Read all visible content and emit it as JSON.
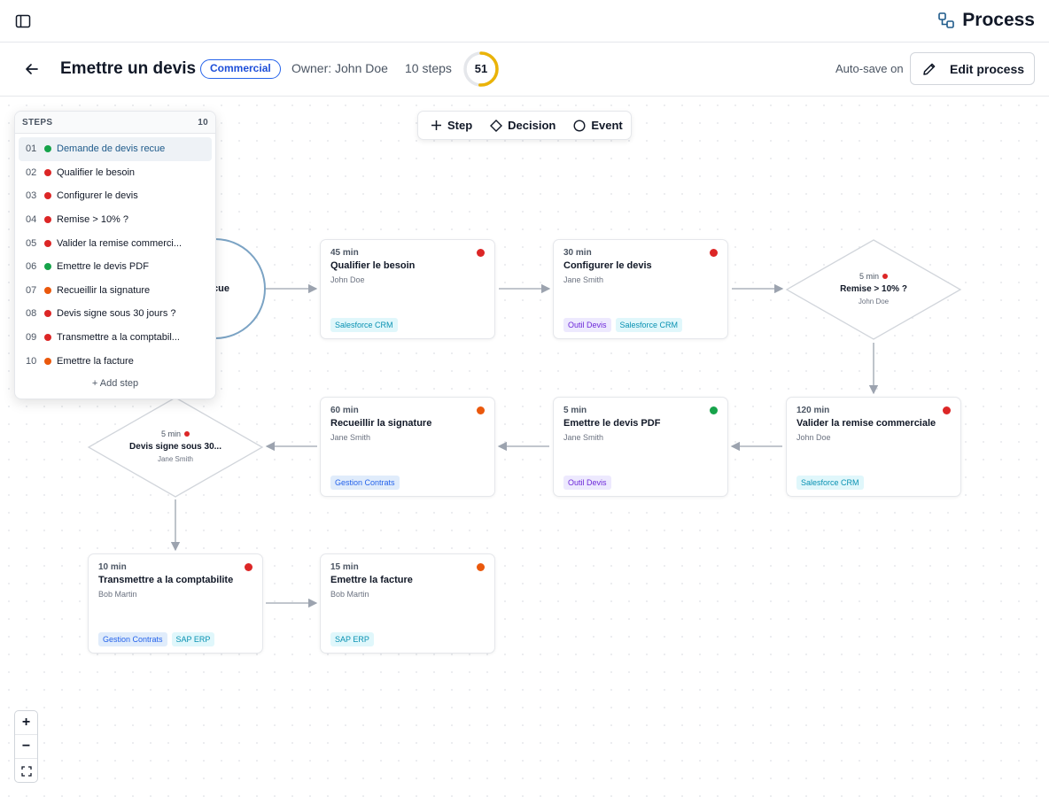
{
  "brand": {
    "title": "Process"
  },
  "header": {
    "title": "Emettre un devis",
    "badge": "Commercial",
    "owner": "Owner: John Doe",
    "steps": "10 steps",
    "score": "51",
    "score_value": 51,
    "autosave": "Auto-save on",
    "edit_label": "Edit process"
  },
  "toolbar": {
    "step": "Step",
    "decision": "Decision",
    "event": "Event"
  },
  "panel": {
    "title": "STEPS",
    "count": "10",
    "add_label": "Add step",
    "items": [
      {
        "n": "01",
        "label": "Demande de devis recue",
        "color": "#16a34a"
      },
      {
        "n": "02",
        "label": "Qualifier le besoin",
        "color": "#dc2626"
      },
      {
        "n": "03",
        "label": "Configurer le devis",
        "color": "#dc2626"
      },
      {
        "n": "04",
        "label": "Remise > 10% ?",
        "color": "#dc2626"
      },
      {
        "n": "05",
        "label": "Valider la remise commerci...",
        "color": "#dc2626"
      },
      {
        "n": "06",
        "label": "Emettre le devis PDF",
        "color": "#16a34a"
      },
      {
        "n": "07",
        "label": "Recueillir la signature",
        "color": "#ea580c"
      },
      {
        "n": "08",
        "label": "Devis signe sous 30 jours ?",
        "color": "#dc2626"
      },
      {
        "n": "09",
        "label": "Transmettre a la comptabil...",
        "color": "#dc2626"
      },
      {
        "n": "10",
        "label": "Emettre la facture",
        "color": "#ea580c"
      }
    ]
  },
  "event": {
    "label": "cue"
  },
  "nodes": {
    "qualifier": {
      "dur": "45 min",
      "name": "Qualifier le besoin",
      "who": "John Doe",
      "tag1": "Salesforce CRM"
    },
    "configurer": {
      "dur": "30 min",
      "name": "Configurer le devis",
      "who": "Jane Smith",
      "tag1": "Outil Devis",
      "tag2": "Salesforce CRM"
    },
    "valider": {
      "dur": "120 min",
      "name": "Valider la remise commerciale",
      "who": "John Doe",
      "tag1": "Salesforce CRM"
    },
    "pdf": {
      "dur": "5 min",
      "name": "Emettre le devis PDF",
      "who": "Jane Smith",
      "tag1": "Outil Devis"
    },
    "signature": {
      "dur": "60 min",
      "name": "Recueillir la signature",
      "who": "Jane Smith",
      "tag1": "Gestion Contrats"
    },
    "compta": {
      "dur": "10 min",
      "name": "Transmettre a la comptabilite",
      "who": "Bob Martin",
      "tag1": "Gestion Contrats",
      "tag2": "SAP ERP"
    },
    "facture": {
      "dur": "15 min",
      "name": "Emettre la facture",
      "who": "Bob Martin",
      "tag1": "SAP ERP"
    }
  },
  "decisions": {
    "remise": {
      "dur": "5 min",
      "name": "Remise > 10% ?",
      "who": "John Doe"
    },
    "signe": {
      "dur": "5 min",
      "name": "Devis signe sous 30...",
      "who": "Jane Smith"
    }
  },
  "colors": {
    "red": "#dc2626",
    "green": "#16a34a",
    "orange": "#ea580c",
    "accent": "#2563eb",
    "score": "#eab308"
  }
}
